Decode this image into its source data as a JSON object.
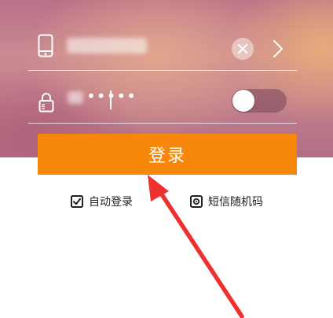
{
  "form": {
    "password_value": "•••••",
    "login_label": "登录"
  },
  "options": {
    "auto_login_label": "自动登录",
    "auto_login_checked": true,
    "sms_code_label": "短信随机码"
  },
  "toggle": {
    "show_password": false
  },
  "colors": {
    "accent": "#f7870a",
    "annotation_arrow": "#ee3030"
  },
  "icons": [
    "phone-icon",
    "clear-icon",
    "chevron-right-icon",
    "lock-icon",
    "checkbox-icon",
    "radio-target-icon",
    "red-arrow-annotation"
  ]
}
